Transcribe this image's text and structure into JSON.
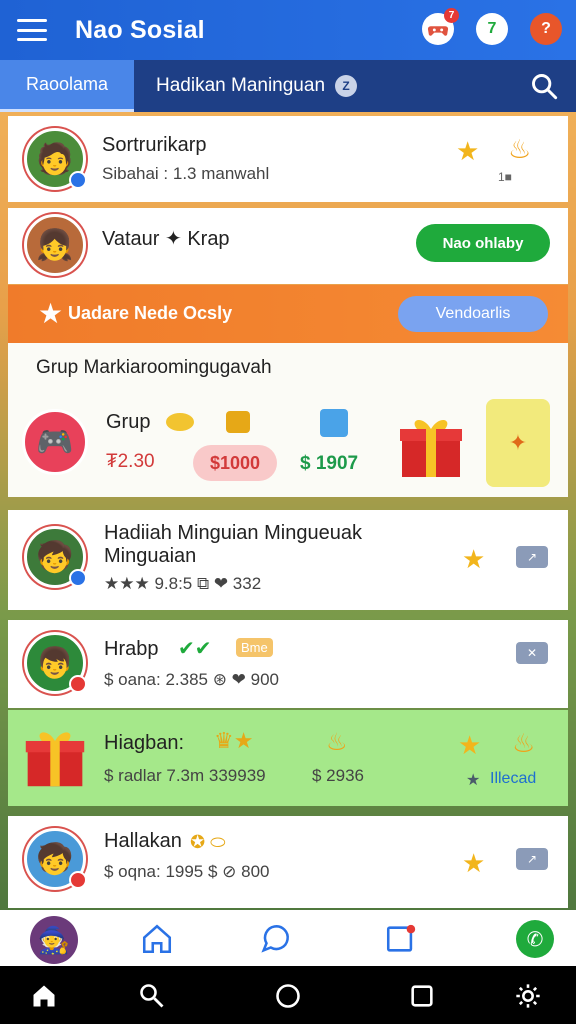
{
  "app": {
    "title": "Nao Sosial"
  },
  "top_icons": [
    {
      "icon": "game-controller-icon",
      "badge": "7"
    },
    {
      "icon": "status-badge-icon",
      "text": "7"
    },
    {
      "icon": "notification-icon",
      "text": "?"
    }
  ],
  "tabs": {
    "active": "Raoolama",
    "second": "Hadikan Maninguan",
    "second_badge": "Z"
  },
  "cards": [
    {
      "title": "Sortrurikarp",
      "sub": "Sibahai : 1.3 manwahl",
      "count": "1■"
    },
    {
      "title": "Vataur ✦ Krap",
      "button": "Nao ohlaby"
    },
    {
      "title": "Hadiiah Minguian Mingueuak Minguaian",
      "sub": "★★★ 9.8:5 ⧉ ❤ 332"
    },
    {
      "title": "Hrabp",
      "tag": "Bme",
      "sub": "$ oana: 2.385 ⊛ ❤ 900"
    },
    {
      "title": "Hiagban:",
      "sub": "$ radlar 7.3m 339939",
      "amount": "$ 2936",
      "link": "Illecad"
    },
    {
      "title": "Hallakan",
      "sub": "$ oqna: 1995 $ ⊘ 800"
    }
  ],
  "promo": {
    "text": "Uadare Nede Ocsly",
    "button": "Vendoarlis"
  },
  "group": {
    "heading": "Grup Markiaroomingugavah",
    "title": "Grup",
    "price_red": "₮2.30",
    "price_badge": "$1000",
    "price_green": "$ 1907"
  },
  "colors": {
    "primary": "#2a72e6",
    "tabbar": "#1e3f86",
    "promo": "#f07b2a",
    "green": "#1faa3c",
    "highlight": "#a5e88a"
  }
}
